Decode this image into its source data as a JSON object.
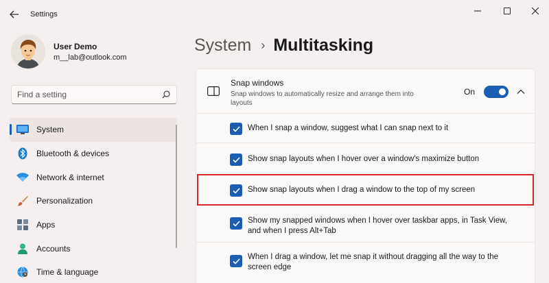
{
  "window": {
    "title": "Settings",
    "back_icon": "back-arrow-icon",
    "controls": [
      "minimize-icon",
      "maximize-icon",
      "close-icon"
    ]
  },
  "profile": {
    "name": "User Demo",
    "email": "m__lab@outlook.com"
  },
  "search": {
    "placeholder": "Find a setting",
    "icon": "search-icon"
  },
  "sidebar": {
    "items": [
      {
        "label": "System",
        "icon": "monitor-icon",
        "active": true
      },
      {
        "label": "Bluetooth & devices",
        "icon": "bluetooth-icon",
        "active": false
      },
      {
        "label": "Network & internet",
        "icon": "wifi-icon",
        "active": false
      },
      {
        "label": "Personalization",
        "icon": "brush-icon",
        "active": false
      },
      {
        "label": "Apps",
        "icon": "apps-icon",
        "active": false
      },
      {
        "label": "Accounts",
        "icon": "person-icon",
        "active": false
      },
      {
        "label": "Time & language",
        "icon": "globe-clock-icon",
        "active": false
      }
    ]
  },
  "breadcrumb": {
    "parent": "System",
    "separator": "›",
    "current": "Multitasking"
  },
  "snap": {
    "title": "Snap windows",
    "description": "Snap windows to automatically resize and arrange them into layouts",
    "toggle_label": "On",
    "toggle_on": true,
    "options": [
      {
        "label": "When I snap a window, suggest what I can snap next to it",
        "checked": true
      },
      {
        "label": "Show snap layouts when I hover over a window's maximize button",
        "checked": true
      },
      {
        "label": "Show snap layouts when I drag a window to the top of my screen",
        "checked": true
      },
      {
        "label": "Show my snapped windows when I hover over taskbar apps, in Task View, and when I press Alt+Tab",
        "checked": true
      },
      {
        "label": "When I drag a window, let me snap it without dragging all the way to the screen edge",
        "checked": true
      }
    ]
  },
  "colors": {
    "accent": "#1a5fb4",
    "highlight": "#d8252b",
    "background": "#f6efef"
  }
}
